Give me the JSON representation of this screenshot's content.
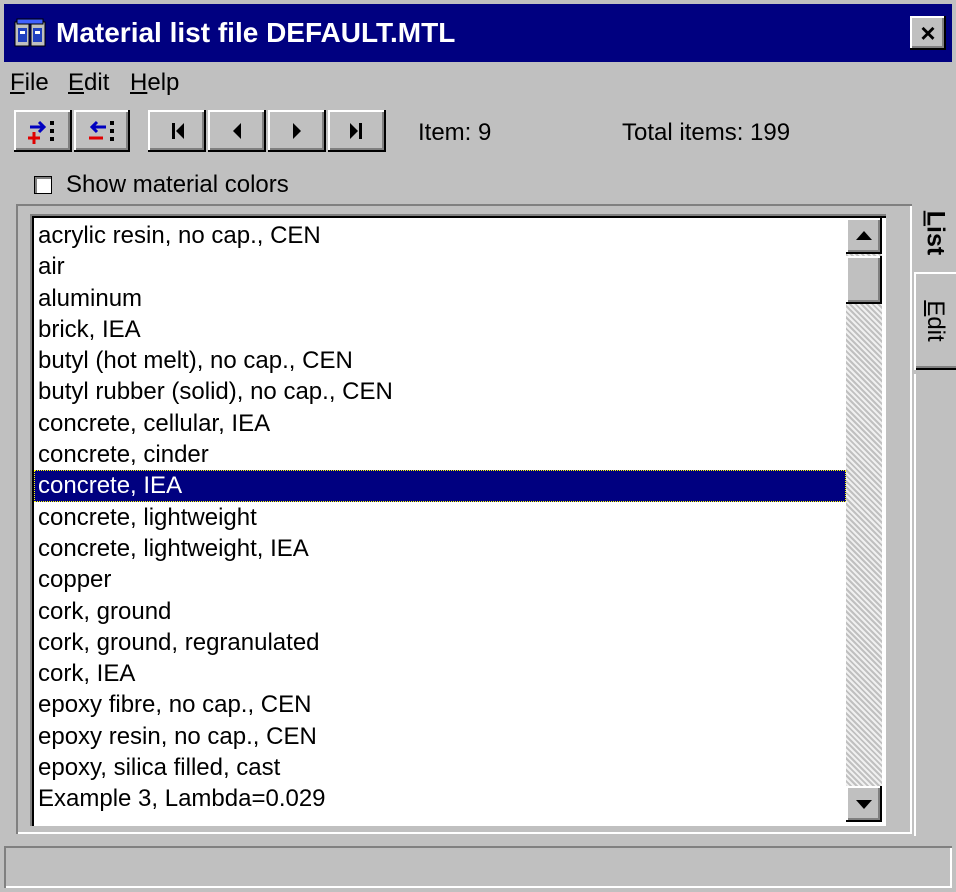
{
  "window": {
    "title": "Material list file DEFAULT.MTL",
    "close_label": "×"
  },
  "menu": [
    {
      "label": "File"
    },
    {
      "label": "Edit"
    },
    {
      "label": "Help"
    }
  ],
  "toolbar": {
    "item_label": "Item: 9",
    "total_label": "Total items: 199"
  },
  "options": {
    "show_colors_label": "Show material colors",
    "show_colors_checked": false
  },
  "tabs": [
    {
      "label": "List",
      "active": true
    },
    {
      "label": "Edit",
      "active": false
    }
  ],
  "materials": {
    "selected_index": 8,
    "items": [
      "acrylic resin, no cap., CEN",
      "air",
      "aluminum",
      "brick, IEA",
      "butyl (hot melt), no cap., CEN",
      "butyl rubber (solid), no cap., CEN",
      "concrete, cellular, IEA",
      "concrete, cinder",
      "concrete, IEA",
      "concrete, lightweight",
      "concrete, lightweight, IEA",
      "copper",
      "cork, ground",
      "cork, ground, regranulated",
      "cork, IEA",
      "epoxy fibre, no cap., CEN",
      "epoxy resin, no cap., CEN",
      "epoxy, silica filled, cast",
      "Example 3, Lambda=0.029"
    ]
  },
  "colors": {
    "titlebar": "#000080",
    "selection": "#000080",
    "face": "#c0c0c0"
  }
}
